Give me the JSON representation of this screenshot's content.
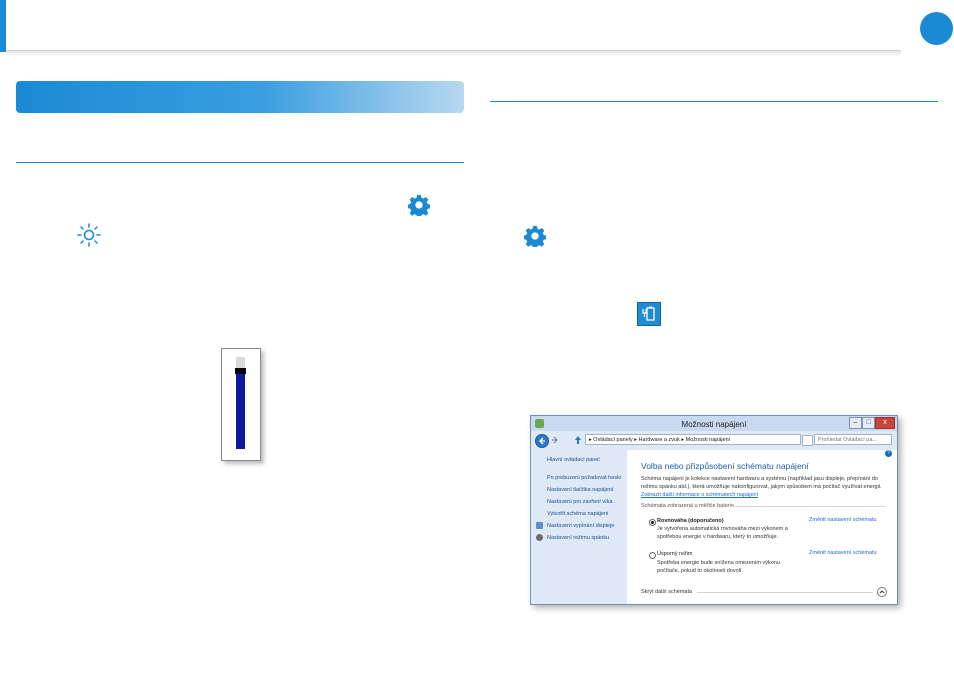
{
  "window": {
    "title": "Možnosti napájení",
    "minimize": "–",
    "maximize": "□",
    "close": "x",
    "address_parts": [
      "Ovládací panely",
      "Hardware a zvuk",
      "Možnosti napájení"
    ],
    "address": "▸ Ovládací panely ▸ Hardware a zvuk ▸ Možnosti napájení",
    "search_placeholder": "Prohledat Ovládací pa..."
  },
  "sidebar": {
    "home": "Hlavní ovládací panel",
    "items": [
      "Po probuzení požadovat heslo",
      "Nastavení tlačítka napájení",
      "Nastavení pro zavření víka",
      "Vytvořit schéma napájení",
      "Nastavení vypínání displeje",
      "Nastavení režimu spánku"
    ]
  },
  "content": {
    "heading": "Volba nebo přizpůsobení schématu napájení",
    "intro": "Schéma napájení je kolekce nastavení hardwaru a systému (například jasu displeje, přepínání do režimu spánku atd.), která umožňuje nakonfigurovat, jakým způsobem má počítač využívat energii.",
    "intro_link": "Zobrazit další informace o schématech napájení",
    "group_label": "Schémata zobrazená u měřiče baterie",
    "plans": [
      {
        "name": "Rovnováha (doporučeno)",
        "description": "Je vytvořena automatická rovnováha mezi výkonem a spotřebou energie v hardwaru, který to umožňuje.",
        "link": "Změnit nastavení schématu",
        "selected": true
      },
      {
        "name": "Úsporný režim",
        "description": "Spotřeba energie bude snížena omezením výkonu počítače, pokud to okolnosti dovolí.",
        "link": "Změnit nastavení schématu",
        "selected": false
      }
    ],
    "footer": "Skrýt další schémata"
  },
  "brightness_slider": {
    "level_fraction": 0.85
  },
  "colors": {
    "accent": "#1a8ad4",
    "slider_fill": "#0d1aa0"
  },
  "icons": {
    "settings_icon_1": "gear-icon",
    "brightness_icon": "sun-icon",
    "settings_icon_2": "gear-icon",
    "battery_icon": "battery-plug-icon",
    "help_icon": "help-icon"
  }
}
